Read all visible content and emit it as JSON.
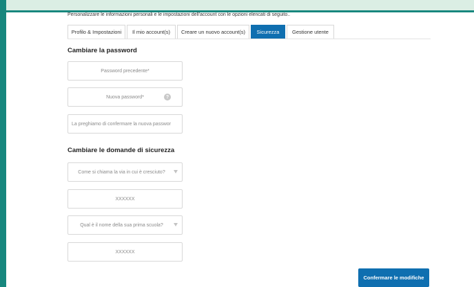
{
  "intro": "Personalizzare le informazioni personali e le impostazioni dell'account con le opzioni elencati di seguito..",
  "tabs": [
    {
      "label": "Profilo & Impostazioni",
      "active": false
    },
    {
      "label": "Il mio account(s)",
      "active": false
    },
    {
      "label": "Creare un nuovo account(s)",
      "active": false
    },
    {
      "label": "Sicurezza",
      "active": true
    },
    {
      "label": "Gestione utente",
      "active": false
    }
  ],
  "password_section": {
    "title": "Cambiare la password",
    "old_placeholder": "Password precedente*",
    "new_placeholder": "Nuova password*",
    "confirm_placeholder": "La preghiamo di confermare la nuova passwor",
    "help_icon": "question-icon"
  },
  "security_section": {
    "title": "Cambiare le domande di sicurezza",
    "question1": "Come si chiama la via in cui è cresciuto?",
    "answer1": "XXXXXX",
    "question2": "Qual è il nome della sua prima scuola?",
    "answer2": "XXXXXX"
  },
  "confirm_label": "Confermare le modifiche",
  "colors": {
    "teal": "#17877e",
    "mint": "#dbeee4",
    "primary": "#0f6fb0"
  }
}
